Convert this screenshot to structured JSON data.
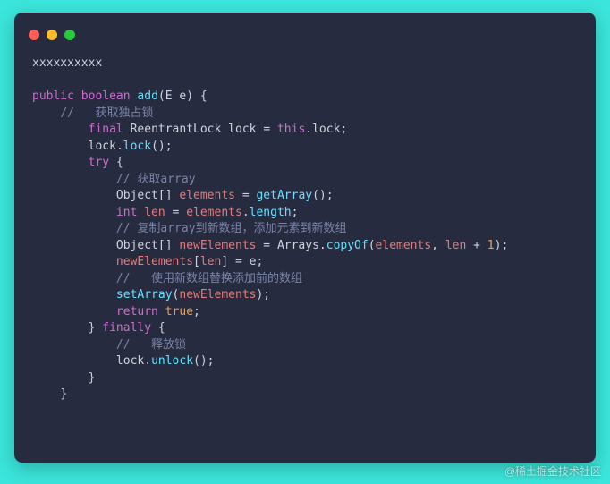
{
  "window": {
    "dots": [
      "red",
      "yellow",
      "green"
    ]
  },
  "code": {
    "line1": "xxxxxxxxxx",
    "kw_public": "public",
    "kw_boolean": "boolean",
    "fn_add": "add",
    "param_E": "E",
    "param_e": "e",
    "cmt_acquire": "//   获取独占锁",
    "kw_final": "final",
    "type_ReentrantLock": "ReentrantLock",
    "var_lock": "lock",
    "kw_this": "this",
    "fn_lock": "lock",
    "kw_try": "try",
    "cmt_getarray": "// 获取array",
    "type_Object": "Object",
    "var_elements": "elements",
    "fn_getArray": "getArray",
    "kw_int": "int",
    "var_len": "len",
    "fn_length": "length",
    "cmt_copy": "// 复制array到新数组，添加元素到新数组",
    "var_newElements": "newElements",
    "cls_Arrays": "Arrays",
    "fn_copyOf": "copyOf",
    "num_1": "1",
    "cmt_replace": "//   使用新数组替换添加前的数组",
    "fn_setArray": "setArray",
    "kw_return": "return",
    "bool_true": "true",
    "kw_finally": "finally",
    "cmt_release": "//   释放锁",
    "fn_unlock": "unlock"
  },
  "watermark": "@稀土掘金技术社区"
}
